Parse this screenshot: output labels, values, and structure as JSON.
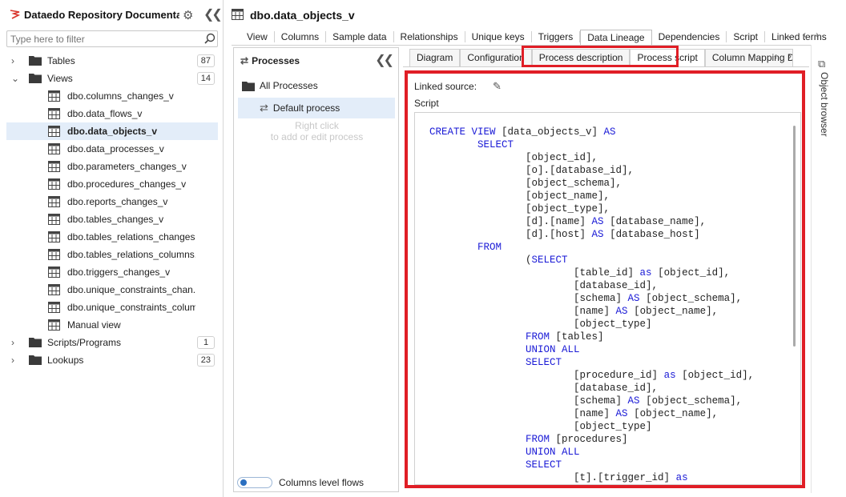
{
  "repo_title": "Dataedo Repository Documentati...",
  "filter_placeholder": "Type here to filter",
  "tree": {
    "tables": {
      "label": "Tables",
      "count": "87"
    },
    "views": {
      "label": "Views",
      "count": "14"
    },
    "view_items": [
      "dbo.columns_changes_v",
      "dbo.data_flows_v",
      "dbo.data_objects_v",
      "dbo.data_processes_v",
      "dbo.parameters_changes_v",
      "dbo.procedures_changes_v",
      "dbo.reports_changes_v",
      "dbo.tables_changes_v",
      "dbo.tables_relations_changes...",
      "dbo.tables_relations_columns...",
      "dbo.triggers_changes_v",
      "dbo.unique_constraints_chan...",
      "dbo.unique_constraints_colum...",
      "Manual view"
    ],
    "scripts": {
      "label": "Scripts/Programs",
      "count": "1"
    },
    "lookups": {
      "label": "Lookups",
      "count": "23"
    }
  },
  "object_title": "dbo.data_objects_v",
  "top_tabs": [
    "View",
    "Columns",
    "Sample data",
    "Relationships",
    "Unique keys",
    "Triggers",
    "Data Lineage",
    "Dependencies",
    "Script",
    "Linked terms"
  ],
  "processes": {
    "title": "Processes",
    "all": "All Processes",
    "default": "Default process",
    "hint1": "Right click",
    "hint2": "to add or edit process",
    "toggle_label": "Columns level flows"
  },
  "inner_tabs": [
    "Diagram",
    "Configuration",
    "Process description",
    "Process script",
    "Column Mapping Defin"
  ],
  "script_panel": {
    "linked_source_label": "Linked source:",
    "script_label": "Script"
  },
  "object_browser": "Object browser",
  "colors": {
    "accent": "#2a6fc0",
    "highlight": "#e01e26",
    "keyword": "#1a1ad6"
  }
}
